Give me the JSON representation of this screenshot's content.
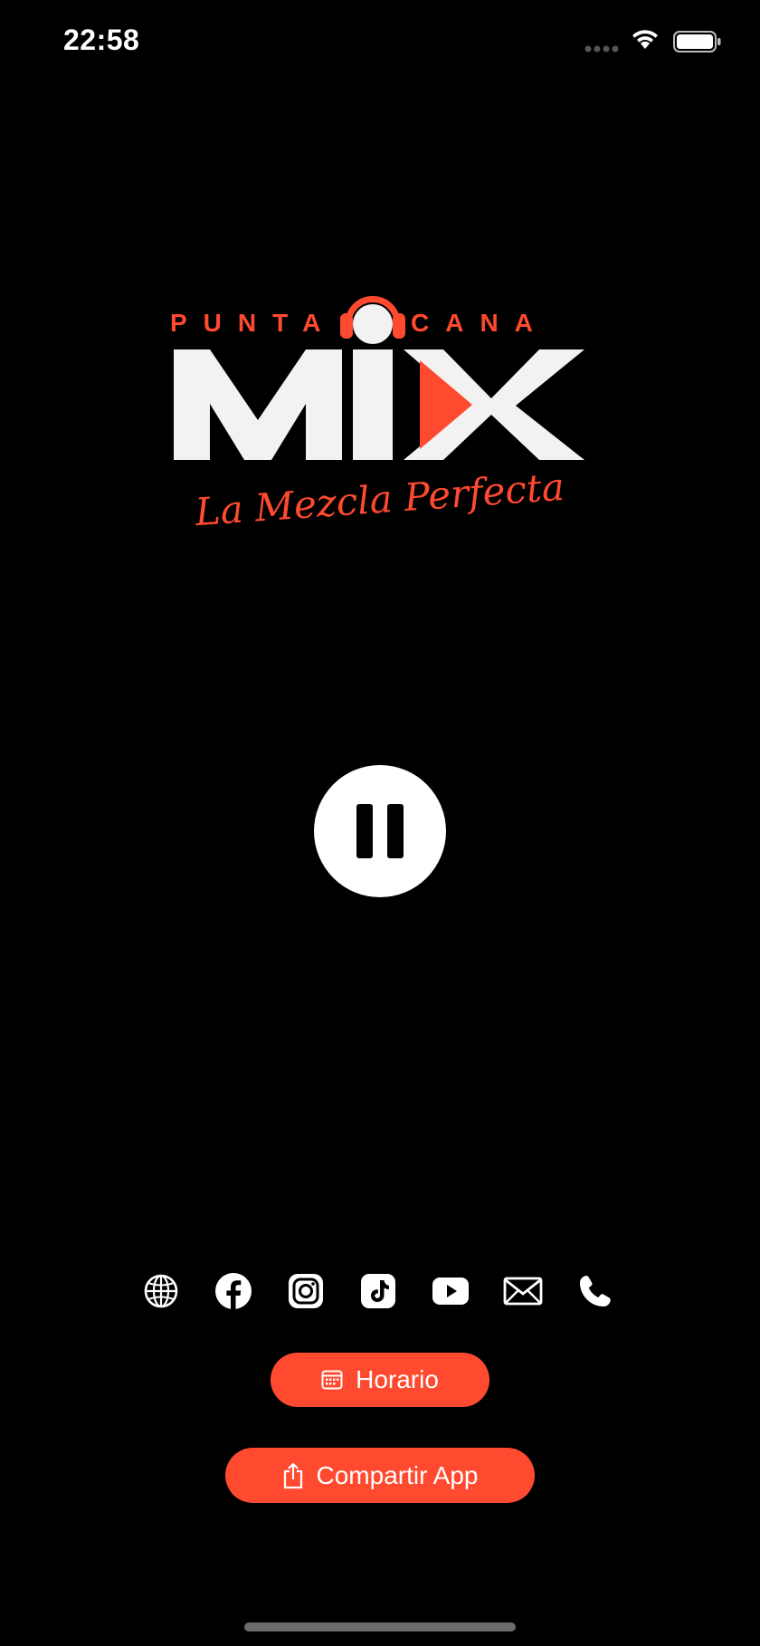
{
  "status_bar": {
    "time": "22:58"
  },
  "logo": {
    "top_words": [
      "PUNTA",
      "CANA"
    ],
    "brand_word": "MIX",
    "tagline": "La Mezcla Perfecta",
    "accent_color": "#ff4a30",
    "mark_color": "#f2f2f2"
  },
  "player": {
    "state": "playing",
    "control_icon": "pause-icon"
  },
  "social_links": [
    {
      "name": "website",
      "icon": "globe-icon"
    },
    {
      "name": "facebook",
      "icon": "facebook-icon"
    },
    {
      "name": "instagram",
      "icon": "instagram-icon"
    },
    {
      "name": "tiktok",
      "icon": "tiktok-icon"
    },
    {
      "name": "youtube",
      "icon": "youtube-icon"
    },
    {
      "name": "email",
      "icon": "envelope-icon"
    },
    {
      "name": "phone",
      "icon": "phone-icon"
    }
  ],
  "buttons": {
    "schedule_label": "Horario",
    "share_label": "Compartir App"
  },
  "colors": {
    "background": "#000000",
    "accent": "#ff4a30",
    "foreground": "#ffffff"
  }
}
